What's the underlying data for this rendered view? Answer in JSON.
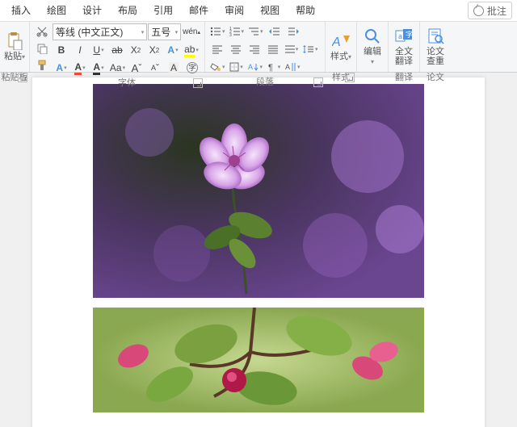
{
  "menubar": {
    "items": [
      "插入",
      "绘图",
      "设计",
      "布局",
      "引用",
      "邮件",
      "审阅",
      "视图",
      "帮助"
    ],
    "comments_button": "批注"
  },
  "ribbon": {
    "clipboard": {
      "paste_label": "粘贴",
      "group_label": "粘贴板"
    },
    "font": {
      "family": "等线 (中文正文)",
      "size": "五号",
      "group_label": "字体"
    },
    "paragraph": {
      "group_label": "段落"
    },
    "styles": {
      "label": "样式",
      "group_label": "样式"
    },
    "editing": {
      "label": "编辑"
    },
    "translate": {
      "label_line1": "全文",
      "label_line2": "翻译",
      "group_label": "翻译"
    },
    "thesis": {
      "label_line1": "论文",
      "label_line2": "查重",
      "group_label": "论文"
    }
  }
}
